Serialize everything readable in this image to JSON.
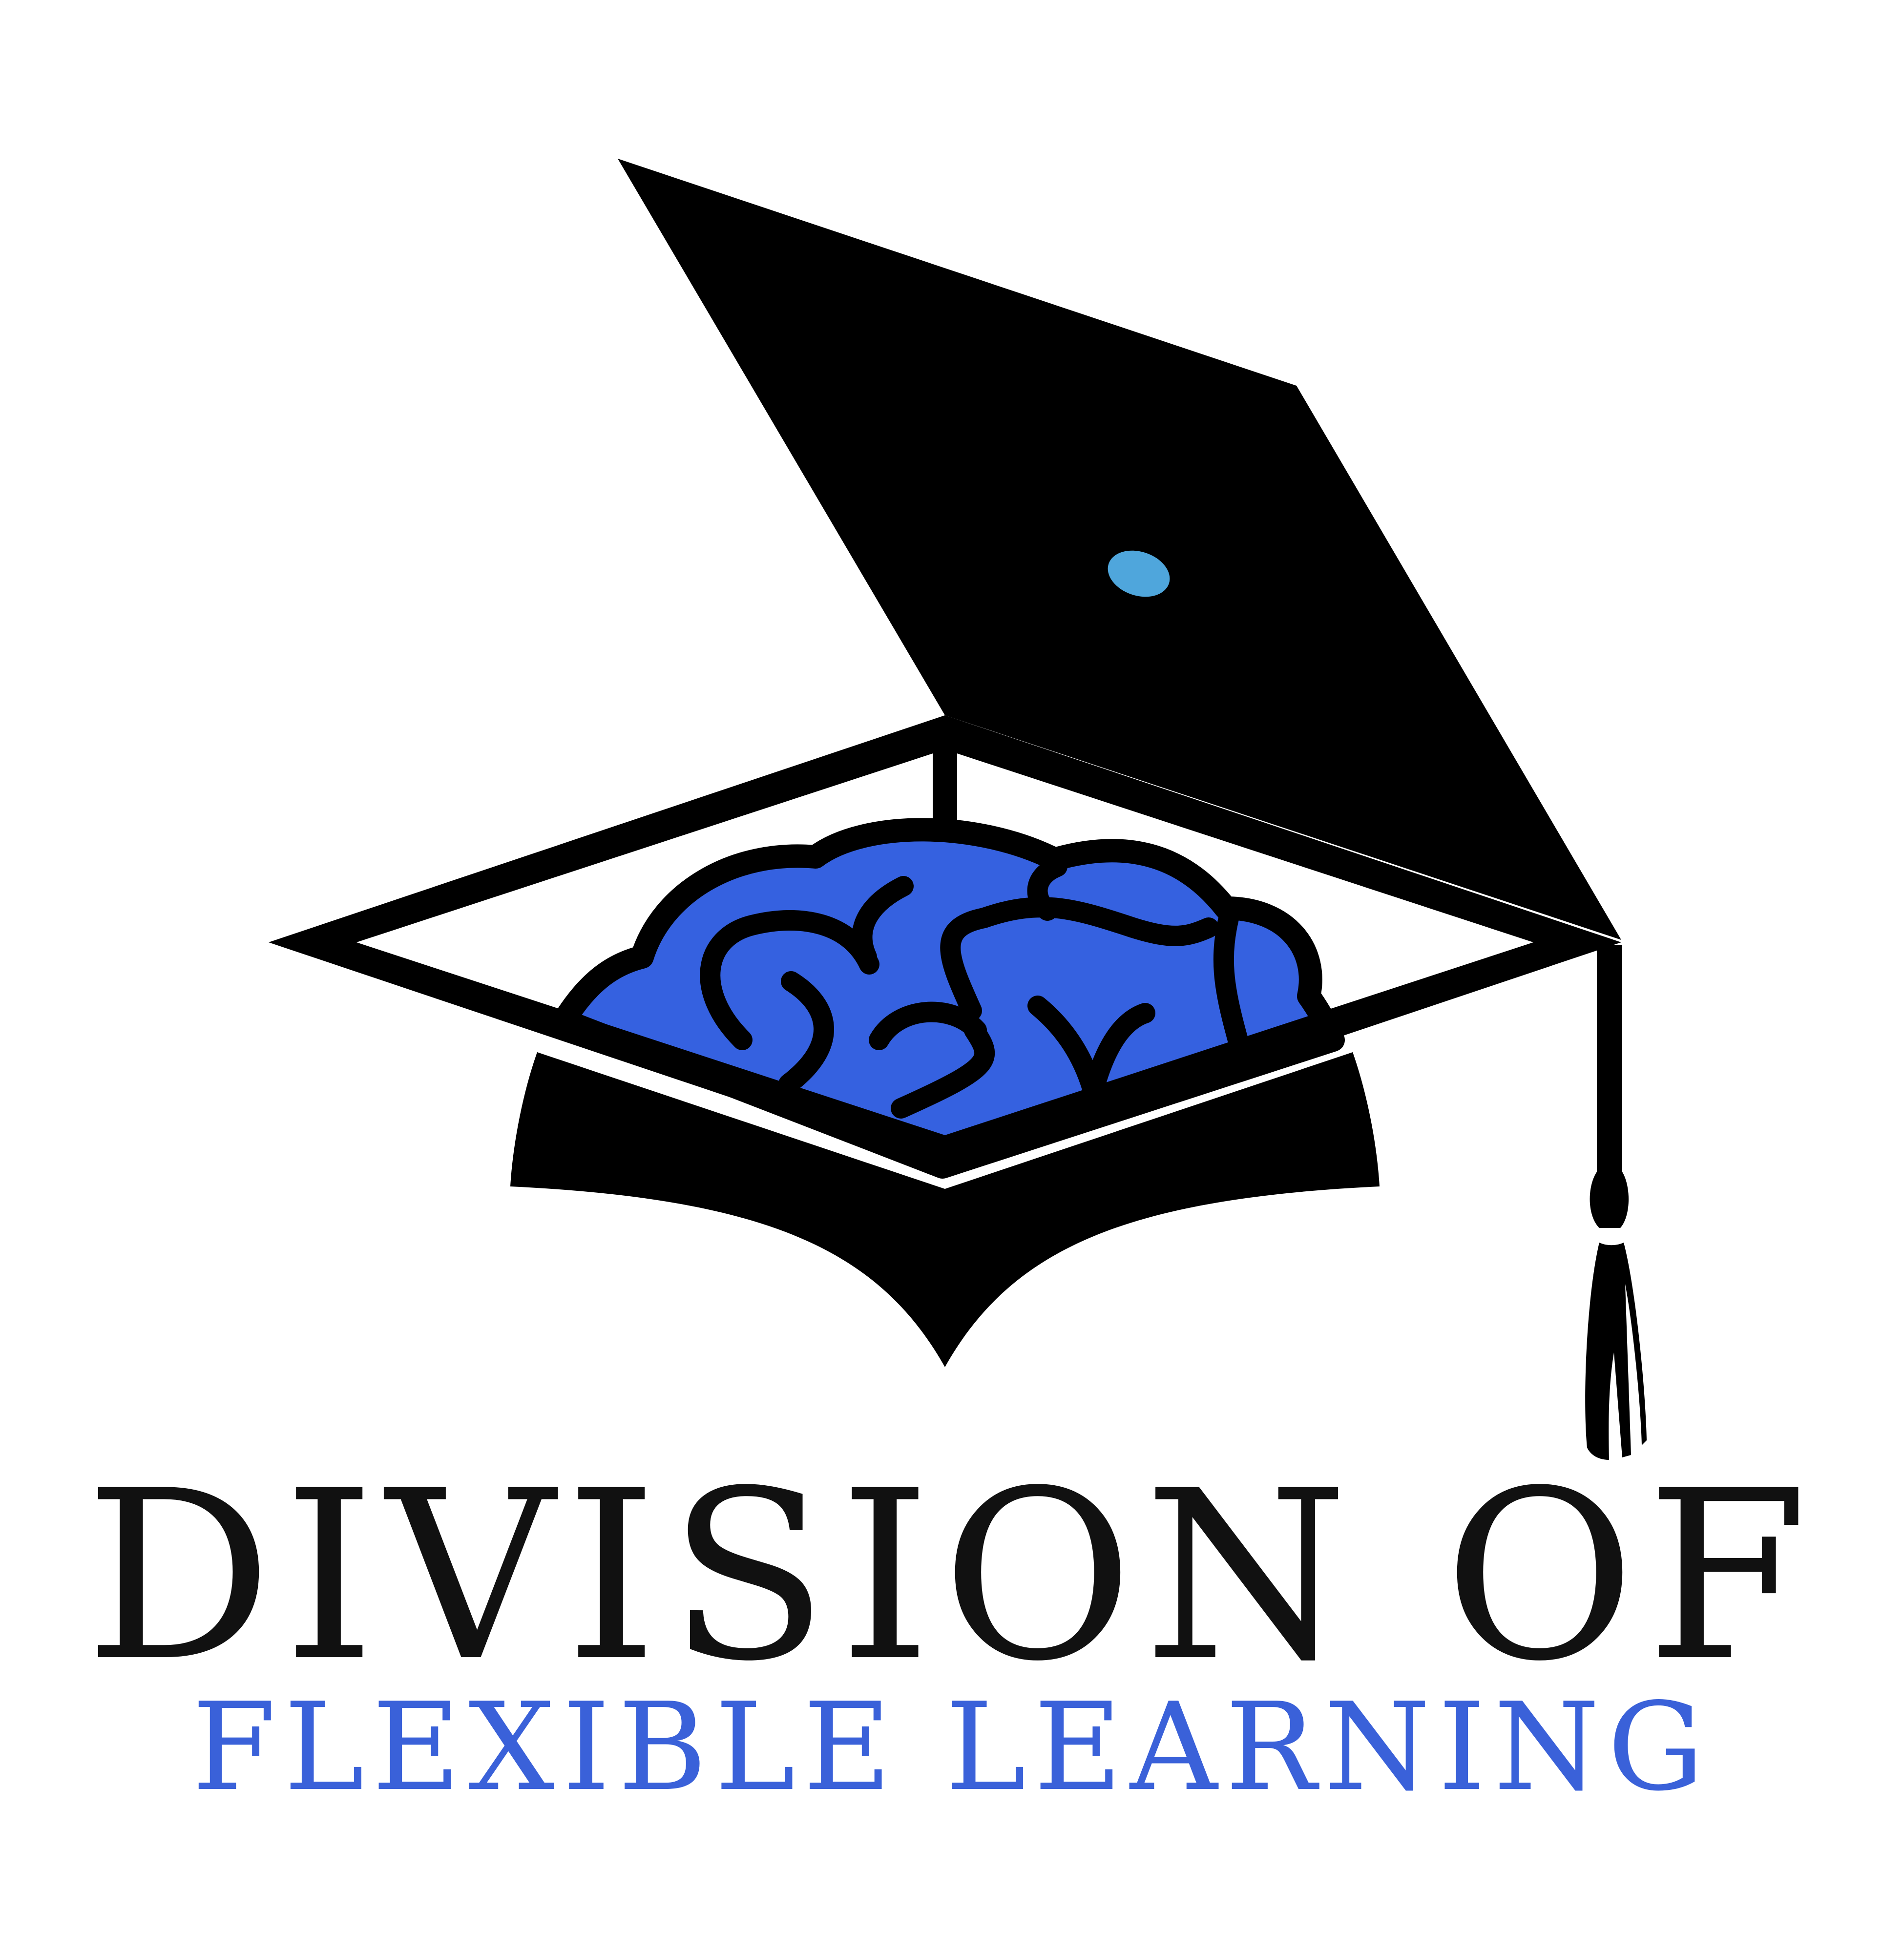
{
  "logo": {
    "emblem": "graduation-cap-with-brain",
    "line1": "DIVISION OF",
    "line2": "FLEXIBLE LEARNING"
  },
  "colors": {
    "background": "#ffffff",
    "cap": "#000000",
    "brain": "#3561e0",
    "button": "#4fa6dc",
    "line1": "#111111",
    "line2": "#3a61d9"
  }
}
